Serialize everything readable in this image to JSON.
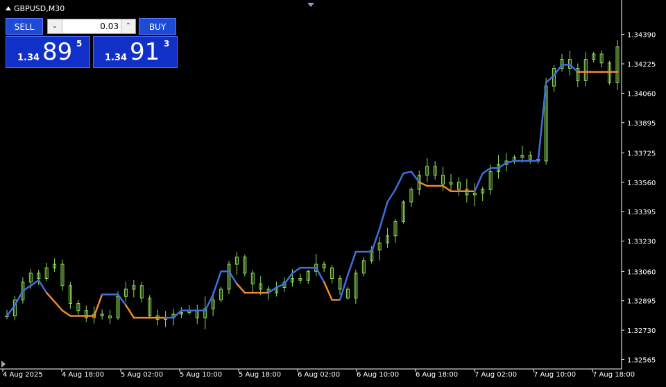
{
  "header": {
    "symbol": "GBPUSD,M30"
  },
  "trade_panel": {
    "sell_label": "SELL",
    "buy_label": "BUY",
    "lot_value": "0.03",
    "sell_price": {
      "prefix": "1.34",
      "big": "89",
      "sup": "5"
    },
    "buy_price": {
      "prefix": "1.34",
      "big": "91",
      "sup": "3"
    }
  },
  "colors": {
    "candle": "#8fe05a",
    "trend_up": "#3f6fe0",
    "trend_down": "#f08a2a",
    "background": "#000000"
  },
  "chart_data": {
    "type": "line",
    "title": "",
    "ylim": [
      1.3252,
      1.3456
    ],
    "y_ticks": [
      "1.34390",
      "1.34225",
      "1.34060",
      "1.33895",
      "1.33725",
      "1.33560",
      "1.33395",
      "1.33230",
      "1.33060",
      "1.32895",
      "1.32730",
      "1.32565"
    ],
    "x_ticks": [
      "4 Aug 2025",
      "4 Aug 18:00",
      "5 Aug 02:00",
      "5 Aug 10:00",
      "5 Aug 18:00",
      "6 Aug 02:00",
      "6 Aug 10:00",
      "6 Aug 18:00",
      "7 Aug 02:00",
      "7 Aug 10:00",
      "7 Aug 18:00"
    ],
    "grid": false,
    "series": [
      {
        "color": "#8fe05a",
        "close": [
          1.3281,
          1.329,
          1.33,
          1.3305,
          1.3302,
          1.3308,
          1.331,
          1.3298,
          1.3288,
          1.3284,
          1.328,
          1.3282,
          1.3281,
          1.328,
          1.3292,
          1.3296,
          1.3298,
          1.3291,
          1.3281,
          1.3279,
          1.328,
          1.3282,
          1.3283,
          1.3284,
          1.328,
          1.3285,
          1.329,
          1.3296,
          1.331,
          1.3314,
          1.3305,
          1.3299,
          1.3296,
          1.3294,
          1.3297,
          1.33,
          1.3302,
          1.3301,
          1.3306,
          1.331,
          1.3308,
          1.3302,
          1.3296,
          1.3291,
          1.3305,
          1.3312,
          1.3318,
          1.3322,
          1.3326,
          1.3334,
          1.3345,
          1.3352,
          1.336,
          1.3365,
          1.336,
          1.3355,
          1.3356,
          1.3352,
          1.3349,
          1.335,
          1.3352,
          1.3362,
          1.3366,
          1.3368,
          1.337,
          1.3371,
          1.3369,
          1.3368,
          1.341,
          1.342,
          1.3425,
          1.342,
          1.3413,
          1.3425,
          1.3428,
          1.3423,
          1.3412,
          1.3432
        ]
      },
      {
        "name_up": "up",
        "color_up": "#3f6fe0",
        "color_down": "#f08a2a",
        "trend": [
          1.3281,
          1.3287,
          1.3295,
          1.3298,
          1.3301,
          1.3294,
          1.3289,
          1.3284,
          1.3281,
          1.3281,
          1.3281,
          1.3281,
          1.3293,
          1.3293,
          1.3293,
          1.3287,
          1.328,
          1.328,
          1.328,
          1.328,
          1.328,
          1.328,
          1.3284,
          1.3284,
          1.3284,
          1.3284,
          1.3293,
          1.3306,
          1.3306,
          1.3299,
          1.3294,
          1.3294,
          1.3294,
          1.3294,
          1.3297,
          1.3299,
          1.3305,
          1.3308,
          1.3308,
          1.3308,
          1.33,
          1.329,
          1.329,
          1.3304,
          1.3317,
          1.3317,
          1.3317,
          1.333,
          1.3345,
          1.3352,
          1.3361,
          1.3362,
          1.3356,
          1.3354,
          1.3354,
          1.3354,
          1.3351,
          1.3351,
          1.3351,
          1.3351,
          1.3361,
          1.3364,
          1.3364,
          1.3367,
          1.3368,
          1.3368,
          1.3368,
          1.3368,
          1.3412,
          1.3416,
          1.3422,
          1.3422,
          1.3418,
          1.3418,
          1.3418,
          1.3418,
          1.3418,
          1.3418
        ],
        "direction": [
          "u",
          "u",
          "u",
          "u",
          "u",
          "d",
          "d",
          "d",
          "d",
          "d",
          "d",
          "d",
          "u",
          "u",
          "u",
          "d",
          "d",
          "d",
          "d",
          "d",
          "u",
          "u",
          "u",
          "u",
          "u",
          "u",
          "u",
          "u",
          "u",
          "d",
          "d",
          "d",
          "d",
          "u",
          "u",
          "u",
          "u",
          "u",
          "u",
          "u",
          "d",
          "d",
          "u",
          "u",
          "u",
          "u",
          "u",
          "u",
          "u",
          "u",
          "u",
          "u",
          "d",
          "d",
          "d",
          "d",
          "d",
          "d",
          "d",
          "u",
          "u",
          "u",
          "u",
          "u",
          "u",
          "u",
          "u",
          "u",
          "u",
          "u",
          "u",
          "u",
          "d",
          "d",
          "d",
          "d",
          "d",
          "d"
        ]
      }
    ]
  }
}
